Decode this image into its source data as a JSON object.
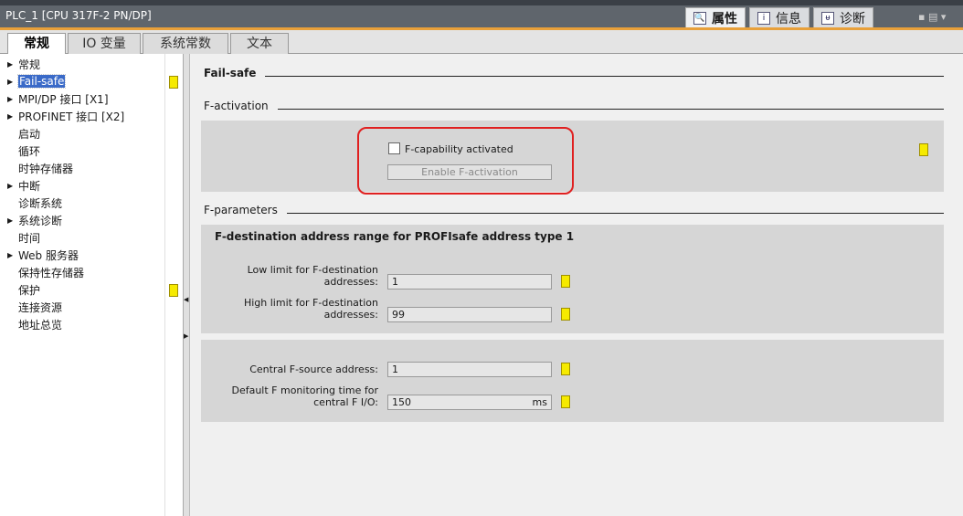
{
  "window": {
    "title": "PLC_1 [CPU 317F-2 PN/DP]"
  },
  "inspector_tabs": [
    {
      "label": "属性",
      "icon": "properties-icon",
      "active": true
    },
    {
      "label": "信息",
      "icon": "info-icon"
    },
    {
      "label": "诊断",
      "icon": "diagnostics-icon"
    }
  ],
  "tabs": [
    {
      "label": "常规",
      "active": true
    },
    {
      "label": "IO 变量"
    },
    {
      "label": "系统常数"
    },
    {
      "label": "文本"
    }
  ],
  "nav": [
    {
      "label": "常规",
      "arrow": true
    },
    {
      "label": "Fail-safe",
      "arrow": true,
      "selected": true,
      "marker": true
    },
    {
      "label": "MPI/DP 接口 [X1]",
      "arrow": true
    },
    {
      "label": "PROFINET 接口 [X2]",
      "arrow": true
    },
    {
      "label": "启动"
    },
    {
      "label": "循环"
    },
    {
      "label": "时钟存储器"
    },
    {
      "label": "中断",
      "arrow": true
    },
    {
      "label": "诊断系统"
    },
    {
      "label": "系统诊断",
      "arrow": true
    },
    {
      "label": "时间"
    },
    {
      "label": "Web 服务器",
      "arrow": true
    },
    {
      "label": "保持性存储器"
    },
    {
      "label": "保护",
      "marker": true
    },
    {
      "label": "连接资源"
    },
    {
      "label": "地址总览"
    }
  ],
  "main": {
    "section_title": "Fail-safe",
    "activation": {
      "heading": "F-activation",
      "checkbox_label": "F-capability activated",
      "checked": false,
      "button_label": "Enable F-activation"
    },
    "parameters": {
      "heading": "F-parameters",
      "group_title": "F-destination address range for PROFIsafe address type 1",
      "low_label": [
        "Low limit for F-destination",
        "addresses:"
      ],
      "low_value": "1",
      "high_label": [
        "High limit for F-destination",
        "addresses:"
      ],
      "high_value": "99",
      "source_label": "Central F-source address:",
      "source_value": "1",
      "monitor_label": [
        "Default F monitoring time for",
        "central F I/O:"
      ],
      "monitor_value": "150",
      "monitor_unit": "ms"
    }
  },
  "colors": {
    "marker": "#f6ea00",
    "highlight": "#e02020",
    "accent": "#e8a03a"
  }
}
